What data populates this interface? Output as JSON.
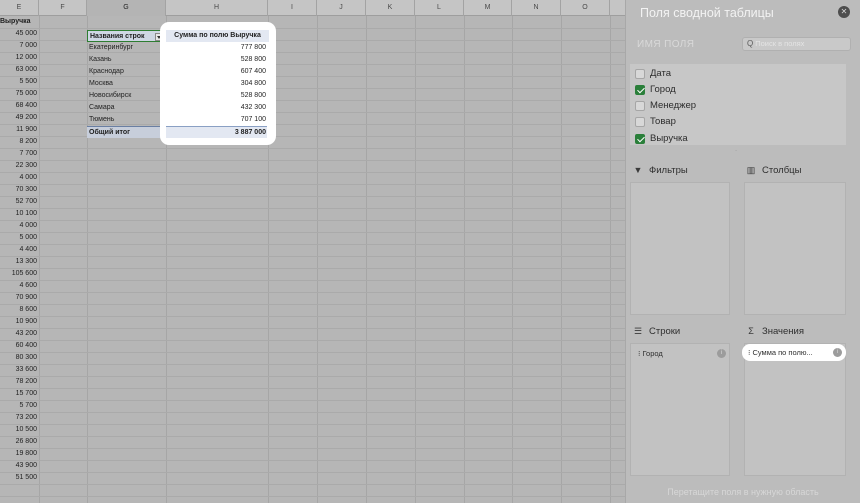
{
  "sheet": {
    "columns": [
      {
        "letter": "E"
      },
      {
        "letter": "F"
      },
      {
        "letter": "G"
      },
      {
        "letter": "H"
      },
      {
        "letter": "I"
      },
      {
        "letter": "J"
      },
      {
        "letter": "K"
      },
      {
        "letter": "L"
      },
      {
        "letter": "M"
      },
      {
        "letter": "N"
      },
      {
        "letter": "O"
      }
    ],
    "col_e_header": "Выручка",
    "col_e_values": [
      "45 000",
      "7 000",
      "12 000",
      "63 000",
      "5 500",
      "75 000",
      "68 400",
      "49 200",
      "11 900",
      "8 200",
      "7 700",
      "22 300",
      "4 000",
      "70 300",
      "52 700",
      "10 100",
      "4 000",
      "5 000",
      "4 400",
      "13 300",
      "105 600",
      "4 600",
      "70 900",
      "8 600",
      "10 900",
      "43 200",
      "60 400",
      "80 300",
      "33 600",
      "78 200",
      "15 700",
      "5 700",
      "73 200",
      "10 500",
      "26 800",
      "19 800",
      "43 900",
      "51 500"
    ]
  },
  "pivot": {
    "row_header": "Названия строк",
    "value_header": "Сумма по полю Выручка",
    "rows": [
      {
        "label": "Екатеринбург",
        "value": "777 800"
      },
      {
        "label": "Казань",
        "value": "528 800"
      },
      {
        "label": "Краснодар",
        "value": "607 400"
      },
      {
        "label": "Москва",
        "value": "304 800"
      },
      {
        "label": "Новосибирск",
        "value": "528 800"
      },
      {
        "label": "Самара",
        "value": "432 300"
      },
      {
        "label": "Тюмень",
        "value": "707 100"
      }
    ],
    "total_label": "Общий итог",
    "total_value": "3 887 000"
  },
  "pane": {
    "title": "Поля сводной таблицы",
    "field_name_label": "ИМЯ ПОЛЯ",
    "search_placeholder": "Поиск в полях",
    "fields": [
      {
        "label": "Дата",
        "checked": false
      },
      {
        "label": "Город",
        "checked": true
      },
      {
        "label": "Менеджер",
        "checked": false
      },
      {
        "label": "Товар",
        "checked": false
      },
      {
        "label": "Выручка",
        "checked": true
      }
    ],
    "filters_label": "Фильтры",
    "columns_label": "Столбцы",
    "rows_label": "Строки",
    "values_label": "Значения",
    "rows_chip": "Город",
    "values_chip": "Сумма по полю...",
    "footer": "Перетащите поля в нужную область",
    "accent_color": "#2a7f3a"
  }
}
